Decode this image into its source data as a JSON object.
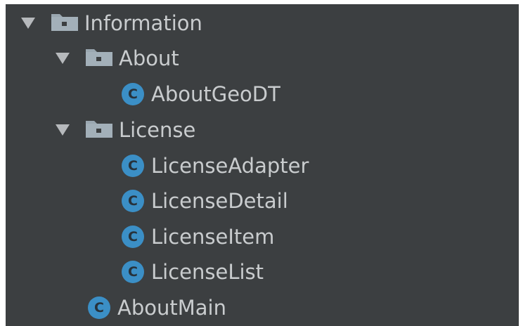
{
  "tree": {
    "nodes": [
      {
        "label": "Information",
        "kind": "folder",
        "expanded": true,
        "icon": "folder-icon"
      },
      {
        "label": "About",
        "kind": "folder",
        "expanded": true,
        "icon": "folder-icon"
      },
      {
        "label": "AboutGeoDT",
        "kind": "class",
        "icon": "class-icon",
        "badge": "C"
      },
      {
        "label": "License",
        "kind": "folder",
        "expanded": true,
        "icon": "folder-icon"
      },
      {
        "label": "LicenseAdapter",
        "kind": "class",
        "icon": "class-icon",
        "badge": "C"
      },
      {
        "label": "LicenseDetail",
        "kind": "class",
        "icon": "class-icon",
        "badge": "C"
      },
      {
        "label": "LicenseItem",
        "kind": "class",
        "icon": "class-icon",
        "badge": "C"
      },
      {
        "label": "LicenseList",
        "kind": "class",
        "icon": "class-icon",
        "badge": "C"
      },
      {
        "label": "AboutMain",
        "kind": "class",
        "icon": "class-icon",
        "badge": "C"
      }
    ]
  },
  "colors": {
    "background": "#3c3f41",
    "text": "#c9ccce",
    "class_badge": "#3b8fc6",
    "folder": "#9aa7b0",
    "arrow": "#b6b9bc"
  }
}
